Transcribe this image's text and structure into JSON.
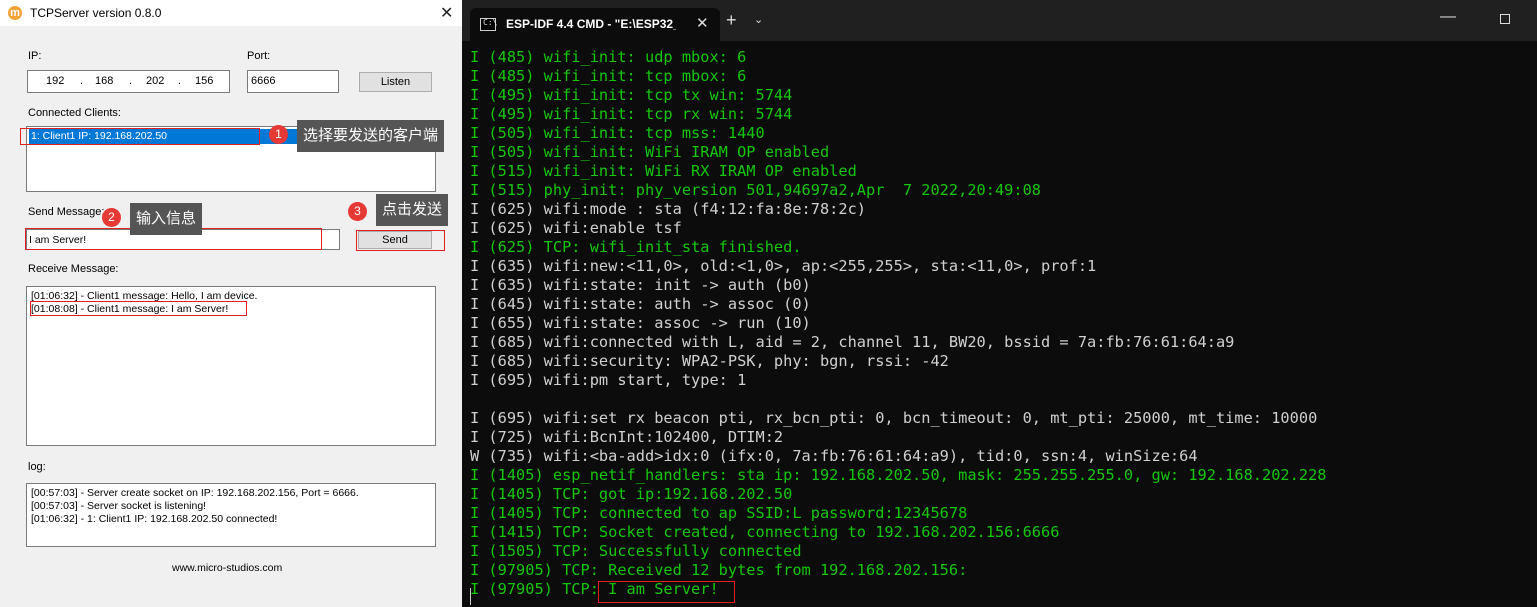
{
  "dialog": {
    "title": "TCPServer version 0.8.0",
    "app_icon": "m",
    "close_glyph": "✕",
    "ip_label": "IP:",
    "ip": [
      "192",
      ".",
      "168",
      ".",
      "202",
      ".",
      "156"
    ],
    "port_label": "Port:",
    "port_value": "6666",
    "listen_label": "Listen",
    "clients_label": "Connected Clients:",
    "clients": [
      "1: Client1 IP: 192.168.202.50"
    ],
    "send_label": "Send Message:",
    "message_value": "I am Server!",
    "send_button": "Send",
    "receive_label": "Receive Message:",
    "received": [
      "[01:06:32] - Client1 message: Hello, I am device.",
      "[01:08:08] - Client1 message: I am Server!"
    ],
    "log_label": "log:",
    "log": [
      "[00:57:03] - Server create socket on IP: 192.168.202.156, Port = 6666.",
      "[00:57:03] - Server socket is listening!",
      "[01:06:32] - 1: Client1 IP: 192.168.202.50 connected!"
    ],
    "footer": "www.micro-studios.com"
  },
  "annotations": [
    {
      "num": "1",
      "text": "选择要发送的客户端"
    },
    {
      "num": "2",
      "text": "输入信息"
    },
    {
      "num": "3",
      "text": "点击发送"
    }
  ],
  "terminal": {
    "tab_title": "ESP-IDF 4.4 CMD - \"E:\\ESP32_",
    "tab_close": "✕",
    "new_tab": "+",
    "tab_menu": "⌄",
    "minimize": "—",
    "lines": [
      {
        "c": "g",
        "t": "I (485) wifi_init: udp mbox: 6"
      },
      {
        "c": "g",
        "t": "I (485) wifi_init: tcp mbox: 6"
      },
      {
        "c": "g",
        "t": "I (495) wifi_init: tcp tx win: 5744"
      },
      {
        "c": "g",
        "t": "I (495) wifi_init: tcp rx win: 5744"
      },
      {
        "c": "g",
        "t": "I (505) wifi_init: tcp mss: 1440"
      },
      {
        "c": "g",
        "t": "I (505) wifi_init: WiFi IRAM OP enabled"
      },
      {
        "c": "g",
        "t": "I (515) wifi_init: WiFi RX IRAM OP enabled"
      },
      {
        "c": "g",
        "t": "I (515) phy_init: phy_version 501,94697a2,Apr  7 2022,20:49:08"
      },
      {
        "c": "w",
        "t": "I (625) wifi:mode : sta (f4:12:fa:8e:78:2c)"
      },
      {
        "c": "w",
        "t": "I (625) wifi:enable tsf"
      },
      {
        "c": "g",
        "t": "I (625) TCP: wifi_init_sta finished."
      },
      {
        "c": "w",
        "t": "I (635) wifi:new:<11,0>, old:<1,0>, ap:<255,255>, sta:<11,0>, prof:1"
      },
      {
        "c": "w",
        "t": "I (635) wifi:state: init -> auth (b0)"
      },
      {
        "c": "w",
        "t": "I (645) wifi:state: auth -> assoc (0)"
      },
      {
        "c": "w",
        "t": "I (655) wifi:state: assoc -> run (10)"
      },
      {
        "c": "w",
        "t": "I (685) wifi:connected with L, aid = 2, channel 11, BW20, bssid = 7a:fb:76:61:64:a9"
      },
      {
        "c": "w",
        "t": "I (685) wifi:security: WPA2-PSK, phy: bgn, rssi: -42"
      },
      {
        "c": "w",
        "t": "I (695) wifi:pm start, type: 1"
      },
      {
        "c": "w",
        "t": ""
      },
      {
        "c": "w",
        "t": "I (695) wifi:set rx beacon pti, rx_bcn_pti: 0, bcn_timeout: 0, mt_pti: 25000, mt_time: 10000"
      },
      {
        "c": "w",
        "t": "I (725) wifi:BcnInt:102400, DTIM:2"
      },
      {
        "c": "w",
        "t": "W (735) wifi:<ba-add>idx:0 (ifx:0, 7a:fb:76:61:64:a9), tid:0, ssn:4, winSize:64"
      },
      {
        "c": "g",
        "t": "I (1405) esp_netif_handlers: sta ip: 192.168.202.50, mask: 255.255.255.0, gw: 192.168.202.228"
      },
      {
        "c": "g",
        "t": "I (1405) TCP: got ip:192.168.202.50"
      },
      {
        "c": "g",
        "t": "I (1405) TCP: connected to ap SSID:L password:12345678"
      },
      {
        "c": "g",
        "t": "I (1415) TCP: Socket created, connecting to 192.168.202.156:6666"
      },
      {
        "c": "g",
        "t": "I (1505) TCP: Successfully connected"
      },
      {
        "c": "g",
        "t": "I (97905) TCP: Received 12 bytes from 192.168.202.156:"
      },
      {
        "c": "g",
        "t": "I (97905) TCP: I am Server!"
      }
    ]
  }
}
